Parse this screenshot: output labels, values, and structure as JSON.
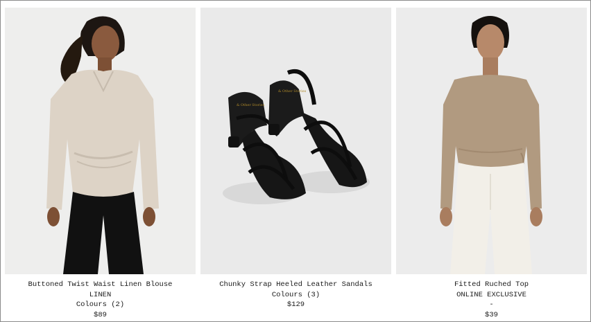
{
  "products": [
    {
      "name": "Buttoned Twist Waist Linen Blouse",
      "tag": "LINEN",
      "colours": "Colours (2)",
      "price": "$89"
    },
    {
      "name": "Chunky Strap Heeled Leather Sandals",
      "colours": "Colours (3)",
      "price": "$129"
    },
    {
      "name": "Fitted Ruched Top",
      "tag": "ONLINE EXCLUSIVE",
      "separator": "-",
      "price": "$39"
    }
  ]
}
